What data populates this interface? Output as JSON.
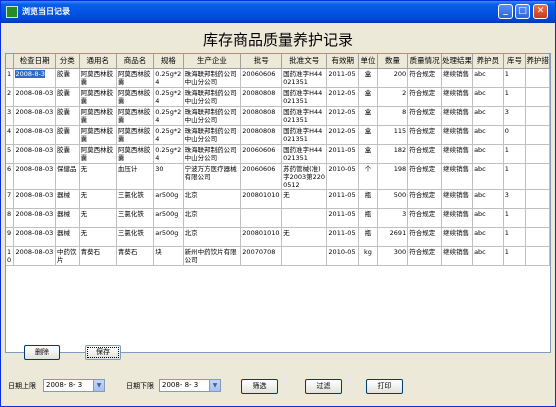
{
  "window": {
    "title": "浏览当日记录",
    "min_label": "_",
    "max_label": "□",
    "close_label": "✕"
  },
  "page": {
    "title": "库存商品质量养护记录"
  },
  "table": {
    "columns": [
      "检查日期",
      "分类",
      "通用名",
      "商品名",
      "规格",
      "生产企业",
      "批号",
      "批准文号",
      "有效期",
      "单位",
      "数量",
      "质量情况",
      "处理结果",
      "养护员",
      "库号",
      "养护措"
    ],
    "rows": [
      [
        "2008-8-3",
        "胶囊",
        "阿莫西林胶囊",
        "阿莫西林胶囊",
        "0.25g*24",
        "珠海联邦制药公司中山分公司",
        "20060606",
        "国药准字H44021351",
        "2011-05",
        "盒",
        "200",
        "符合规定",
        "继续销售",
        "abc",
        "1",
        ""
      ],
      [
        "2008-08-03",
        "胶囊",
        "阿莫西林胶囊",
        "阿莫西林胶囊",
        "0.25g*24",
        "珠海联邦制药公司中山分公司",
        "20080808",
        "国药准字H44021351",
        "2012-05",
        "盒",
        "2",
        "符合规定",
        "继续销售",
        "abc",
        "1",
        ""
      ],
      [
        "2008-08-03",
        "胶囊",
        "阿莫西林胶囊",
        "阿莫西林胶囊",
        "0.25g*24",
        "珠海联邦制药公司中山分公司",
        "20080808",
        "国药准字H44021351",
        "2012-05",
        "盒",
        "8",
        "符合规定",
        "继续销售",
        "abc",
        "3",
        ""
      ],
      [
        "2008-08-03",
        "胶囊",
        "阿莫西林胶囊",
        "阿莫西林胶囊",
        "0.25g*24",
        "珠海联邦制药公司中山分公司",
        "20080808",
        "国药准字H44021351",
        "2012-05",
        "盒",
        "115",
        "符合规定",
        "继续销售",
        "abc",
        "0",
        ""
      ],
      [
        "2008-08-03",
        "胶囊",
        "阿莫西林胶囊",
        "阿莫西林胶囊",
        "0.25g*24",
        "珠海联邦制药公司中山分公司",
        "20060606",
        "国药准字H44021351",
        "2011-05",
        "盒",
        "182",
        "符合规定",
        "继续销售",
        "abc",
        "1",
        ""
      ],
      [
        "2008-08-03",
        "保健品",
        "无",
        "血压计",
        "30",
        "宁波万方医疗器械有限公司",
        "20060606",
        "苏药管械(准)字2003第2200512",
        "2010-05",
        "个",
        "198",
        "符合规定",
        "继续销售",
        "abc",
        "1",
        ""
      ],
      [
        "2008-08-03",
        "器械",
        "无",
        "三氯化铁",
        "ar500g",
        "北京",
        "200801010",
        "无",
        "2011-05",
        "瓶",
        "500",
        "符合规定",
        "继续销售",
        "abc",
        "3",
        ""
      ],
      [
        "2008-08-03",
        "器械",
        "无",
        "三氯化铁",
        "ar500g",
        "北京",
        "",
        "",
        "2011-05",
        "瓶",
        "3",
        "符合规定",
        "继续销售",
        "abc",
        "1",
        ""
      ],
      [
        "2008-08-03",
        "器械",
        "无",
        "三氯化铁",
        "ar500g",
        "北京",
        "200801010",
        "无",
        "2011-05",
        "瓶",
        "2691",
        "符合规定",
        "继续销售",
        "abc",
        "1",
        ""
      ],
      [
        "2008-08-03",
        "中药饮片",
        "青葵石",
        "青葵石",
        "块",
        "新州中药饮片有限公司",
        "20070708",
        "",
        "2010-05",
        "kg",
        "300",
        "符合规定",
        "继续销售",
        "abc",
        "1",
        ""
      ]
    ],
    "row_numbers": [
      "1",
      "2",
      "3",
      "4",
      "5",
      "6",
      "7",
      "8",
      "9",
      "10"
    ]
  },
  "buttons": {
    "delete": "删除",
    "save": "保存",
    "filter": "筛选",
    "apply_filter": "过滤",
    "print": "打印"
  },
  "filters": {
    "upper_label": "日期上限",
    "upper_value": "2008- 8- 3",
    "lower_label": "日期下限",
    "lower_value": "2008- 8- 3"
  }
}
